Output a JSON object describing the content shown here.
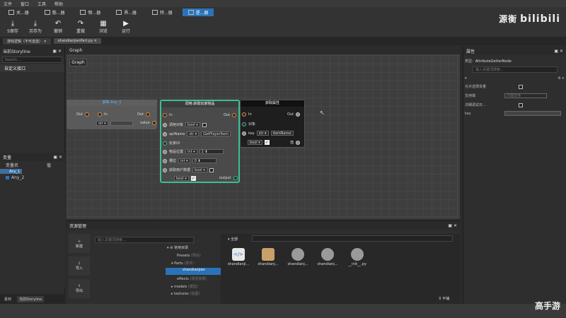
{
  "menu": [
    "文件",
    "窗口",
    "工具",
    "帮助"
  ],
  "editor_tabs": [
    "关...器",
    "筋...器",
    "物...器",
    "界...器",
    "特...器",
    "逻...器"
  ],
  "toolbar": [
    {
      "label": "S保存",
      "icon": "save-icon"
    },
    {
      "label": "另存为",
      "icon": "save-as-icon"
    },
    {
      "label": "撤销",
      "icon": "undo-icon"
    },
    {
      "label": "重做",
      "icon": "redo-icon"
    },
    {
      "label": "浏览",
      "icon": "browse-icon"
    },
    {
      "label": "运行",
      "icon": "run-icon"
    }
  ],
  "logo": {
    "cn": "源衡",
    "en": "bilibili"
  },
  "doc_tabs": [
    "游戏逻辑（不可选选）",
    "shandianjianPart.py"
  ],
  "left": {
    "title": "当前Storyline",
    "search_placeholder": "Search...",
    "custom_interface": "自定义接口",
    "vars_title": "变量",
    "col_name": "变量名",
    "col_value": "值",
    "vars": [
      "Any_1",
      "Any_2"
    ],
    "bottom_tabs": [
      "素材",
      "当前Storyline"
    ]
  },
  "graph": {
    "tab": "Graph",
    "button": "Graph",
    "node1": {
      "title": "获取 Any_1",
      "out": "Out",
      "in": "In",
      "out2": "Out",
      "type": "str",
      "value": "value"
    },
    "node2": {
      "title": "调用:获取玩家物品",
      "in": "In",
      "out": "Out",
      "r1": "调用对象",
      "r1v": "bool",
      "r2": "apiName",
      "r2v": "str",
      "r2t": "GetPlayerItem",
      "r3": "玩家ID",
      "r4": "物品位置",
      "r4v": "int",
      "r4n": "2",
      "r5": "槽位",
      "r5v": "int",
      "r5n": "0",
      "r6": "获取用户数据",
      "r6v": "bool",
      "bool": "bool",
      "output": "output"
    },
    "node3": {
      "title": "获取属性",
      "in": "In",
      "out": "Out",
      "obj": "对象",
      "key": "key",
      "keyv": "str",
      "keyt": "itemName",
      "bool": "bool",
      "val": "值"
    }
  },
  "props": {
    "title": "属性",
    "type_label": "类型:",
    "type_value": "AttributeGetterNode",
    "search_placeholder": "输入关键词搜索...",
    "rows": [
      "允许选择变量",
      "支持端",
      "详细调试日...",
      "key"
    ],
    "support_value": "同端支持"
  },
  "assets": {
    "title": "资源管理",
    "search_placeholder": "输入关键词搜索...",
    "buttons": [
      "新建",
      "导入",
      "导出"
    ],
    "tree": [
      {
        "label": "常用目录",
        "note": ""
      },
      {
        "label": "Presets",
        "note": "(预设)"
      },
      {
        "label": "Parts",
        "note": "(零件)"
      },
      {
        "label": "shandianjian",
        "note": ""
      },
      {
        "label": "effects",
        "note": "(视觉效果)"
      },
      {
        "label": "models",
        "note": "(模型)"
      },
      {
        "label": "textures",
        "note": "(贴图)"
      }
    ],
    "all_label": "全部",
    "files": [
      "shandianji...",
      "shandianj...",
      "shandianj...",
      "shandianj...",
      "__init__.py"
    ],
    "flat_label": "平铺"
  },
  "watermark": "高手游",
  "colors": {
    "accent": "#2a73b8",
    "node_border": "#3cbf8f",
    "pin_orange": "#e08a3c"
  }
}
